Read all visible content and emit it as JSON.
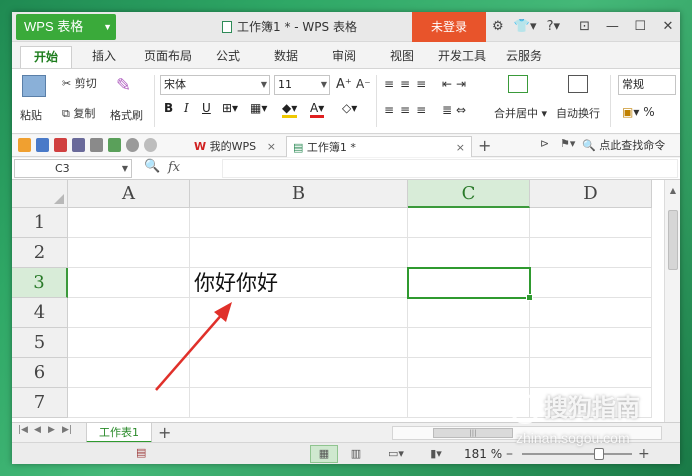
{
  "app": {
    "name": "WPS 表格",
    "window_title": "工作簿1 * - WPS 表格",
    "login": "未登录"
  },
  "menu": {
    "tabs": [
      "开始",
      "插入",
      "页面布局",
      "公式",
      "数据",
      "审阅",
      "视图",
      "开发工具",
      "云服务"
    ],
    "active_tab": "开始"
  },
  "ribbon": {
    "paste": "粘贴",
    "cut": "剪切",
    "copy": "复制",
    "format_painter": "格式刷",
    "font_name": "宋体",
    "font_size": "11",
    "bold": "B",
    "italic": "I",
    "underline": "U",
    "merge_center": "合并居中",
    "wrap_text": "自动换行",
    "number_format": "常规",
    "percent": "%"
  },
  "quickbar": {
    "wps_tab": "我的WPS",
    "doc_tab": "工作簿1 *",
    "search": "点此查找命令"
  },
  "formula_bar": {
    "name_box": "C3",
    "fx": "fx",
    "value": ""
  },
  "sheet": {
    "columns": [
      "A",
      "B",
      "C",
      "D"
    ],
    "rows": [
      "1",
      "2",
      "3",
      "4",
      "5",
      "6",
      "7"
    ],
    "selected_cell": "C3",
    "b3": "你好你好"
  },
  "sheet_tabs": {
    "active": "工作表1",
    "add": "+",
    "scroll_thumb": "|||"
  },
  "status": {
    "zoom": "181 %"
  },
  "watermark": {
    "brand": "搜狗指南",
    "url": "zhinan.sogou.com"
  },
  "colors": {
    "accent": "#2f9a2f",
    "login": "#e8542b",
    "arrow": "#e0302a"
  }
}
